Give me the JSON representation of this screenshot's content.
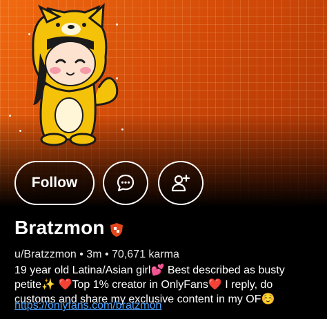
{
  "profile": {
    "display_name": "Bratzmon",
    "meta": "u/Bratzzmon • 3m • 70,671 karma",
    "bio_line1": "19 year old Latina/Asian girl💕 Best described as busty",
    "bio_line2": "petite✨ ❤️Top 1% creator in OnlyFans❤️ I reply, do",
    "bio_line3": "customs and share my exclusive content in my OF☺️",
    "link": "https://onlyfans.com/bratzmon"
  },
  "actions": {
    "follow_label": "Follow"
  },
  "icons": {
    "chat": "chat-bubble-icon",
    "add_user": "add-user-icon",
    "badge": "shield-badge-icon"
  },
  "colors": {
    "banner": "#e05a0c",
    "link": "#4aa3ff",
    "badge": "#e2461c"
  }
}
